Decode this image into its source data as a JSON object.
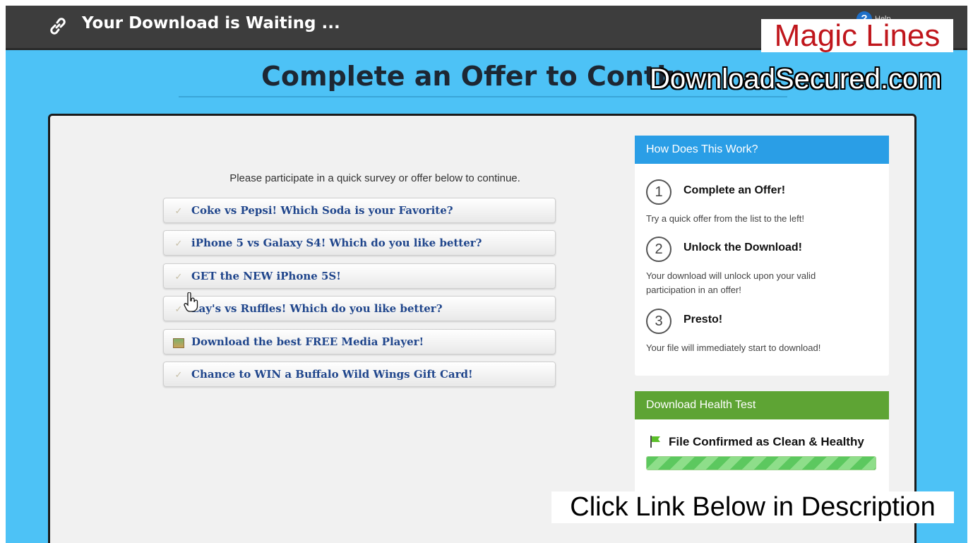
{
  "topbar": {
    "title": "Your Download is Waiting ...",
    "help_label": "Help"
  },
  "page": {
    "heading": "Complete an Offer to Contin"
  },
  "offers": {
    "instruction": "Please participate in a quick survey or offer below to continue.",
    "items": [
      {
        "label": "Coke vs Pepsi! Which Soda is your Favorite?",
        "icon": "checkmark-icon"
      },
      {
        "label": "iPhone 5 vs Galaxy S4! Which do you like better?",
        "icon": "checkmark-icon"
      },
      {
        "label": "GET the NEW iPhone 5S!",
        "icon": "checkmark-icon"
      },
      {
        "label": "Lay's vs Ruffles! Which do you like better?",
        "icon": "checkmark-icon"
      },
      {
        "label": "Download the best FREE Media Player!",
        "icon": "media-icon"
      },
      {
        "label": "Chance to WIN a Buffalo Wild Wings Gift Card!",
        "icon": "checkmark-icon"
      }
    ]
  },
  "how_it_works": {
    "header": "How Does This Work?",
    "steps": [
      {
        "number": "1",
        "title": "Complete an Offer!",
        "desc": "Try a quick offer from the list to the left!"
      },
      {
        "number": "2",
        "title": "Unlock the Download!",
        "desc": "Your download will unlock upon your valid participation in an offer!"
      },
      {
        "number": "3",
        "title": "Presto!",
        "desc": "Your file will immediately start to download!"
      }
    ]
  },
  "health_test": {
    "header": "Download Health Test",
    "status": "File Confirmed as Clean & Healthy",
    "progress_percent": 100
  },
  "overlays": {
    "top": "Magic Lines",
    "domain": "DownloadSecured.com",
    "bottom": "Click Link Below in Description"
  },
  "colors": {
    "page_bg": "#4dc2f6",
    "topbar_bg": "#3d3d3d",
    "how_header": "#2a9ee6",
    "health_header": "#5ea434",
    "offer_text": "#20468c",
    "watermark_red": "#c0161c"
  }
}
